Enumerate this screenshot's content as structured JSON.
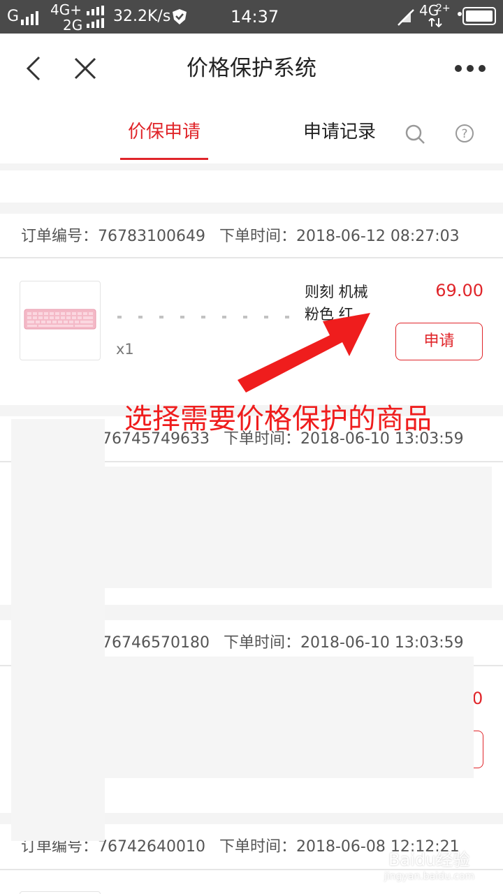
{
  "status_bar": {
    "carrier1": "G",
    "net1": "4G+",
    "net2": "2G",
    "speed": "32.2K/s",
    "time": "14:37",
    "net3": "4G",
    "net3_sup": "2+"
  },
  "nav": {
    "title": "价格保护系统"
  },
  "tabs": {
    "active": "价保申请",
    "records": "申请记录"
  },
  "orders": [
    {
      "number_label": "订单编号：",
      "number": "76783100649",
      "time_label": "下单时间：",
      "time": "2018-06-12 08:27:03",
      "product_name_line1": "则刻 机械",
      "product_name_line2": "粉色 红…",
      "qty": "x1",
      "price": "69.00",
      "action": "申请"
    },
    {
      "number_prefix": "",
      "number": "76745749633",
      "time_label": "下单时间：",
      "time": "2018-06-10 13:03:59"
    },
    {
      "number": "76746570180",
      "time_label": "下单时间：",
      "time": "2018-06-10 13:03:59",
      "price_fragment": "0"
    },
    {
      "number_label": "订单编号：",
      "number": "76742640010",
      "time_label": "下单时间：",
      "time": "2018-06-08 12:12:21"
    }
  ],
  "annotation": {
    "text": "选择需要价格保护的商品"
  },
  "watermark": {
    "brand": "Baidu经验",
    "url": "jingyan.baidu.com"
  },
  "colors": {
    "accent": "#e0252a",
    "statusbar": "#4a4a4a"
  }
}
